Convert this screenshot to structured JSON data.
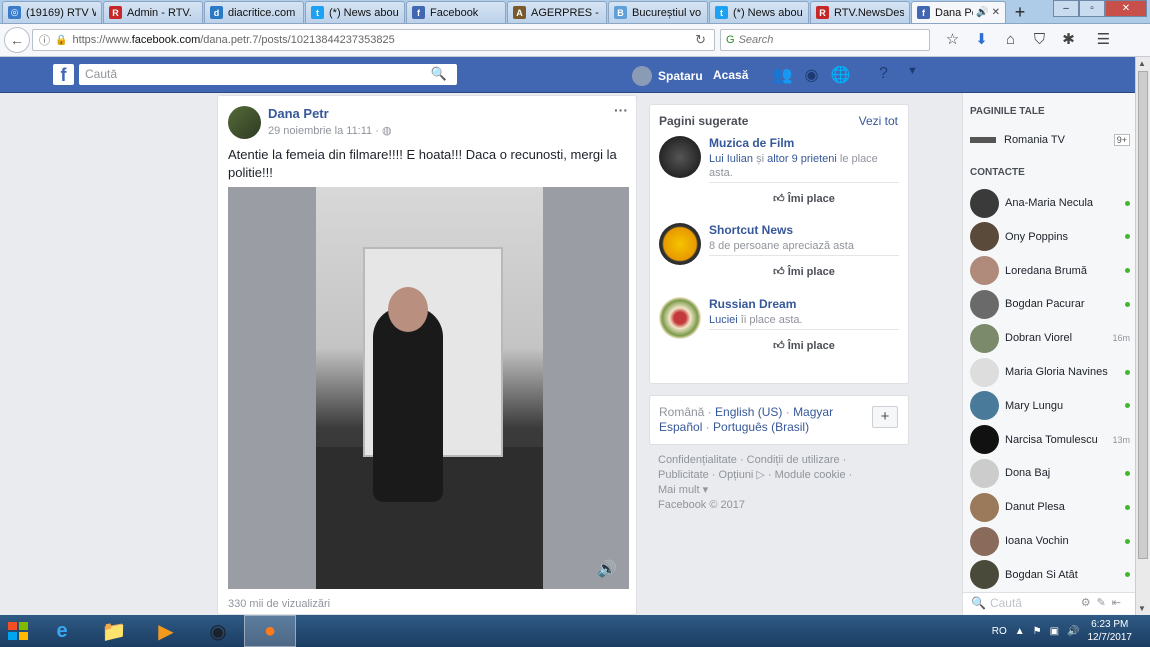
{
  "browser": {
    "tabs": [
      {
        "title": "(19169) RTV W",
        "fav_color": "#3b7bc9",
        "fav_glyph": "◎"
      },
      {
        "title": "Admin - RTV.",
        "fav_color": "#c62828",
        "fav_glyph": "R"
      },
      {
        "title": "diacritice.com",
        "fav_color": "#2b78c5",
        "fav_glyph": "d"
      },
      {
        "title": "(*) News abou",
        "fav_color": "#1da1f2",
        "fav_glyph": "t"
      },
      {
        "title": "Facebook",
        "fav_color": "#4267b2",
        "fav_glyph": "f"
      },
      {
        "title": "AGERPRES - A",
        "fav_color": "#7a5a2a",
        "fav_glyph": "A"
      },
      {
        "title": "Bucureștiul vo",
        "fav_color": "#5fa0d8",
        "fav_glyph": "B"
      },
      {
        "title": "(*) News abou",
        "fav_color": "#1da1f2",
        "fav_glyph": "t"
      },
      {
        "title": "RTV.NewsDes",
        "fav_color": "#c62828",
        "fav_glyph": "R"
      },
      {
        "title": "Dana Pe",
        "fav_color": "#4267b2",
        "fav_glyph": "f"
      }
    ],
    "new_tab": "+",
    "url_prefix": "https://www.",
    "url_domain": "facebook.com",
    "url_rest": "/dana.petr.7/posts/10213844237353825",
    "search_placeholder": "Search"
  },
  "fb": {
    "logo": "f",
    "search_placeholder": "Caută",
    "user": "Spataru",
    "home": "Acasă"
  },
  "post": {
    "author": "Dana Petr",
    "date": "29 noiembrie la 11:11 · ",
    "menu": "···",
    "text": "Atentie la femeia din filmare!!!! E hoata!!! Daca o recunosti, mergi la politie!!!",
    "views": "330 mii de vizualizări"
  },
  "suggested": {
    "header": "Pagini sugerate",
    "see_all": "Vezi tot",
    "like_label": "Îmi place",
    "pages": [
      {
        "name": "Muzica de Film",
        "desc_link": "Lui Iulian",
        "desc_mid": " și ",
        "desc_link2": "altor 9 prieteni",
        "desc_end": " le place asta."
      },
      {
        "name": "Shortcut News",
        "desc_link": "",
        "desc_mid": "8 de persoane apreciază asta",
        "desc_link2": "",
        "desc_end": ""
      },
      {
        "name": "Russian Dream",
        "desc_link": "Luciei",
        "desc_mid": " îi place asta.",
        "desc_link2": "",
        "desc_end": ""
      }
    ]
  },
  "languages": {
    "current": "Română",
    "l1": "English (US)",
    "l2": "Magyar",
    "l3": "Español",
    "l4": "Português (Brasil)",
    "plus": "+"
  },
  "footer": {
    "line1": "Confidențialitate · Condiții de utilizare ·",
    "line2": "Publicitate · Opțiuni ▷ · Module cookie ·",
    "line3": "Mai mult ▾",
    "line4": "Facebook © 2017"
  },
  "chat": {
    "pages_header": "PAGINILE TALE",
    "page_name": "Romania TV",
    "page_badge": "9+",
    "contacts_header": "CONTACTE",
    "contacts": [
      {
        "name": "Ana-Maria Necula",
        "status": ""
      },
      {
        "name": "Ony Poppins",
        "status": ""
      },
      {
        "name": "Loredana Brumă",
        "status": ""
      },
      {
        "name": "Bogdan Pacurar",
        "status": ""
      },
      {
        "name": "Dobran Viorel",
        "status": "16m"
      },
      {
        "name": "Maria Gloria Navines",
        "status": ""
      },
      {
        "name": "Mary Lungu",
        "status": ""
      },
      {
        "name": "Narcisa Tomulescu",
        "status": "13m"
      },
      {
        "name": "Dona Baj",
        "status": ""
      },
      {
        "name": "Danut Plesa",
        "status": ""
      },
      {
        "name": "Ioana Vochin",
        "status": ""
      },
      {
        "name": "Bogdan Si Atât",
        "status": ""
      }
    ],
    "search_placeholder": "Caută"
  },
  "taskbar": {
    "lang": "RO",
    "time": "6:23 PM",
    "date": "12/7/2017"
  }
}
